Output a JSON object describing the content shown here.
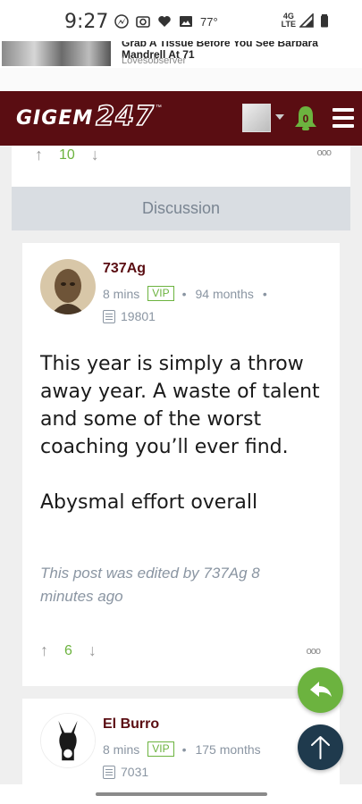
{
  "status_bar": {
    "time": "9:27",
    "temperature": "77°",
    "network": "4G LTE",
    "icons": [
      "messenger-icon",
      "camera-icon",
      "heart-icon",
      "image-icon",
      "signal-icon",
      "battery-icon"
    ]
  },
  "ad": {
    "headline_clipped": "Grab A Tissue Before You See Barbara",
    "headline": "Mandrell At 71",
    "source": "Lovesobserver"
  },
  "header": {
    "logo_text": "GIGEM",
    "logo_number": "247",
    "logo_tm": "™",
    "notification_count": "0",
    "colors": {
      "brand": "#5a0d12",
      "accent": "#6cb33f"
    }
  },
  "prev_post": {
    "upvotes": "10"
  },
  "section_label": "Discussion",
  "posts": [
    {
      "username": "737Ag",
      "time": "8 mins",
      "badge": "VIP",
      "tenure": "94 months",
      "post_count": "19801",
      "body": [
        "This year is simply a throw away year. A waste of talent and some of the worst coaching you’ll ever find.",
        "Abysmal effort overall"
      ],
      "edited_note": "This post was edited by 737Ag 8 minutes ago",
      "upvotes": "6"
    },
    {
      "username": "El Burro",
      "time": "8 mins",
      "badge": "VIP",
      "tenure": "175 months",
      "post_count": "7031"
    }
  ],
  "separator": "•",
  "more_glyph": "ooo",
  "up_arrow": "↑",
  "down_arrow": "↓"
}
